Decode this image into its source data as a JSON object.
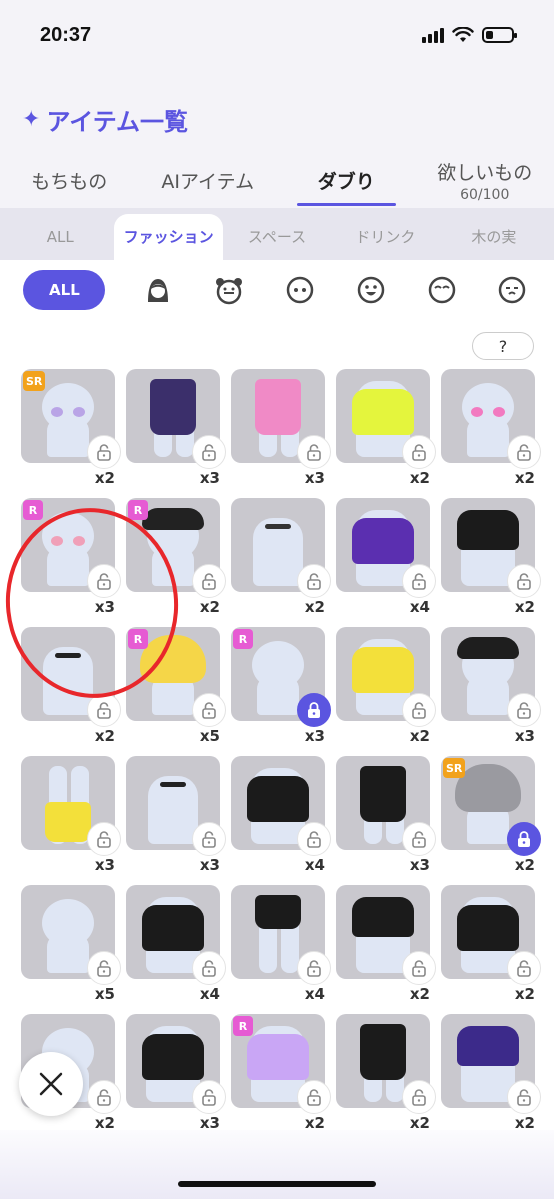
{
  "status": {
    "time": "20:37"
  },
  "header": {
    "title": "アイテム一覧",
    "sparkle_icon": "sparkle-icon"
  },
  "main_tabs": [
    {
      "label": "もちもの",
      "active": false
    },
    {
      "label": "AIアイテム",
      "active": false
    },
    {
      "label": "ダブり",
      "active": true
    },
    {
      "label": "欲しいもの",
      "sub": "60/100",
      "active": false
    }
  ],
  "category_tabs": [
    {
      "label": "ALL",
      "active": false
    },
    {
      "label": "ファッション",
      "active": true
    },
    {
      "label": "スペース",
      "active": false
    },
    {
      "label": "ドリンク",
      "active": false
    },
    {
      "label": "木の実",
      "active": false
    }
  ],
  "filters": {
    "all_label": "ALL",
    "icons": [
      "hair-icon",
      "animal-face-icon",
      "face-icon",
      "smile-face-icon",
      "closed-eyes-face-icon",
      "sleepy-face-icon"
    ]
  },
  "help_label": "?",
  "accent": "#5b55e0",
  "items": [
    {
      "count": "x2",
      "rarity": "SR",
      "locked": false,
      "kind": "eyes",
      "color": "#b9a4e6"
    },
    {
      "count": "x3",
      "rarity": "",
      "locked": false,
      "kind": "pants",
      "color": "#3b2f6b"
    },
    {
      "count": "x3",
      "rarity": "",
      "locked": false,
      "kind": "legs",
      "color": "#f08ac6"
    },
    {
      "count": "x2",
      "rarity": "",
      "locked": false,
      "kind": "top",
      "color": "#e4f53d"
    },
    {
      "count": "x2",
      "rarity": "",
      "locked": false,
      "kind": "glasses",
      "color": "#f27ac0"
    },
    {
      "count": "x3",
      "rarity": "R",
      "locked": false,
      "kind": "eyes",
      "color": "#f0a0b8"
    },
    {
      "count": "x2",
      "rarity": "R",
      "locked": false,
      "kind": "hat",
      "color": "#222222"
    },
    {
      "count": "x2",
      "rarity": "",
      "locked": false,
      "kind": "choker",
      "color": "#333333"
    },
    {
      "count": "x4",
      "rarity": "",
      "locked": false,
      "kind": "top",
      "color": "#5b2fb0"
    },
    {
      "count": "x2",
      "rarity": "",
      "locked": false,
      "kind": "skirt",
      "color": "#1b1b1b"
    },
    {
      "count": "x2",
      "rarity": "",
      "locked": false,
      "kind": "necklace",
      "color": "#222222"
    },
    {
      "count": "x5",
      "rarity": "R",
      "locked": false,
      "kind": "hair",
      "color": "#f5d648"
    },
    {
      "count": "x3",
      "rarity": "R",
      "locked": true,
      "kind": "face",
      "color": "#e8b0b8"
    },
    {
      "count": "x2",
      "rarity": "",
      "locked": false,
      "kind": "top",
      "color": "#f3e03a"
    },
    {
      "count": "x3",
      "rarity": "",
      "locked": false,
      "kind": "hat",
      "color": "#1e1e1e"
    },
    {
      "count": "x3",
      "rarity": "",
      "locked": false,
      "kind": "boots",
      "color": "#f3e03a"
    },
    {
      "count": "x3",
      "rarity": "",
      "locked": false,
      "kind": "choker",
      "color": "#222222"
    },
    {
      "count": "x4",
      "rarity": "",
      "locked": false,
      "kind": "top",
      "color": "#1b1b1b"
    },
    {
      "count": "x3",
      "rarity": "",
      "locked": false,
      "kind": "pants",
      "color": "#1b1b1b"
    },
    {
      "count": "x2",
      "rarity": "SR",
      "locked": true,
      "kind": "hair",
      "color": "#9a9aa0"
    },
    {
      "count": "x5",
      "rarity": "",
      "locked": false,
      "kind": "head",
      "color": "#e8ecf4"
    },
    {
      "count": "x4",
      "rarity": "",
      "locked": false,
      "kind": "jacket",
      "color": "#1b1b1b"
    },
    {
      "count": "x4",
      "rarity": "",
      "locked": false,
      "kind": "shorts",
      "color": "#1b1b1b"
    },
    {
      "count": "x2",
      "rarity": "",
      "locked": false,
      "kind": "skirt",
      "color": "#1b1b1b"
    },
    {
      "count": "x2",
      "rarity": "",
      "locked": false,
      "kind": "top",
      "color": "#1b1b1b"
    },
    {
      "count": "x2",
      "rarity": "",
      "locked": false,
      "kind": "head",
      "color": "#dfe6f4"
    },
    {
      "count": "x3",
      "rarity": "",
      "locked": false,
      "kind": "jacket",
      "color": "#1b1b1b"
    },
    {
      "count": "x2",
      "rarity": "R",
      "locked": false,
      "kind": "top",
      "color": "#c9a6f5"
    },
    {
      "count": "x2",
      "rarity": "",
      "locked": false,
      "kind": "pants",
      "color": "#1b1b1b"
    },
    {
      "count": "x2",
      "rarity": "",
      "locked": false,
      "kind": "skirt",
      "color": "#3c2a8a"
    }
  ]
}
